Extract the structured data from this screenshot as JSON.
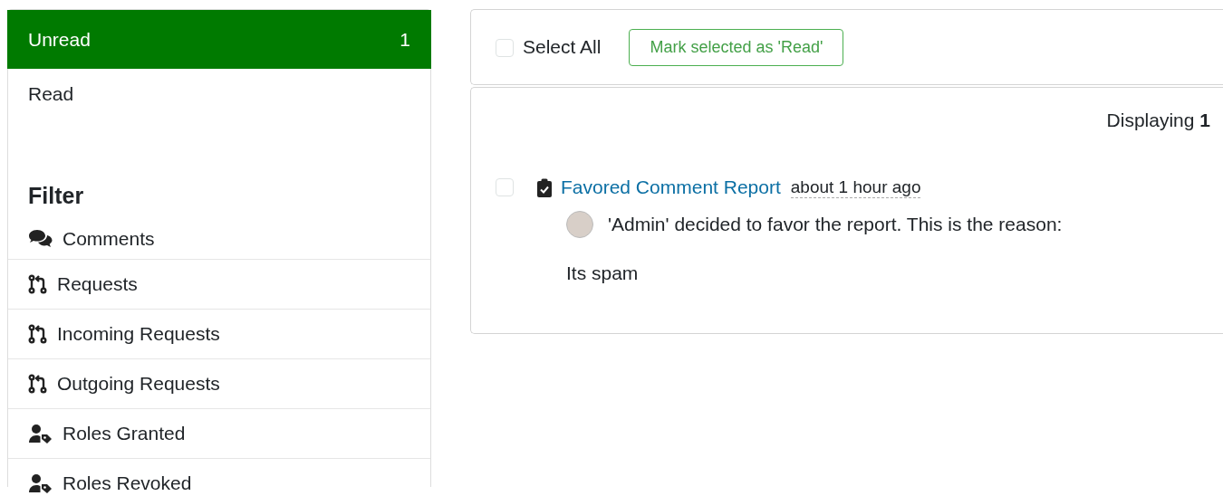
{
  "views": [
    {
      "label": "Unread",
      "count": "1",
      "selected": true
    },
    {
      "label": "Read",
      "selected": false
    }
  ],
  "filter": {
    "heading": "Filter",
    "items": [
      {
        "kind": "comments",
        "label": "Comments"
      },
      {
        "kind": "requests",
        "label": "Requests"
      },
      {
        "kind": "requests",
        "label": "Incoming Requests"
      },
      {
        "kind": "requests",
        "label": "Outgoing Requests"
      },
      {
        "kind": "roles",
        "label": "Roles Granted"
      },
      {
        "kind": "roles",
        "label": "Roles Revoked"
      }
    ]
  },
  "toolbar": {
    "select_all": {
      "label": "Select All",
      "checked": false
    },
    "mark_button": "Mark selected as 'Read'"
  },
  "results": {
    "displaying_label": "Displaying",
    "displaying_count": "1"
  },
  "notifications": [
    {
      "checked": false,
      "title": "Favored Comment Report",
      "time": "about 1 hour ago",
      "message": "'Admin' decided to favor the report. This is the reason:",
      "reason": "Its spam"
    }
  ]
}
